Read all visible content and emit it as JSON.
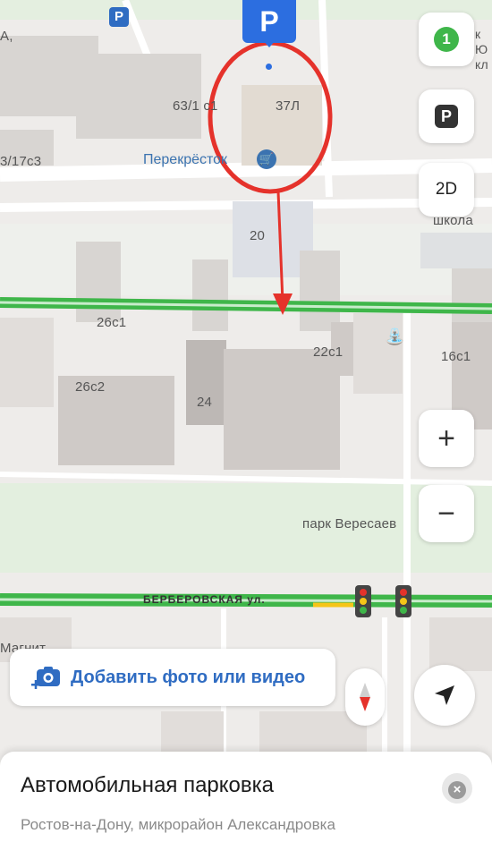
{
  "map": {
    "labels": {
      "a_partial": "А,",
      "b_63_1": "63/1 с1",
      "b_37l": "37Л",
      "b_17c3": "3/17с3",
      "b_20": "20",
      "b_26c1": "26с1",
      "b_22c1": "22с1",
      "b_16c1": "16с1",
      "b_26c2": "26с2",
      "b_24": "24",
      "park": "парк Вересаев",
      "school": "школа",
      "magnit": "Магнит",
      "top_right_1": "к",
      "top_right_2": "Ю",
      "top_right_3": "кл"
    },
    "street": "БЕРБЕРОВСКАЯ ул.",
    "poi": {
      "name": "Перекрёсток",
      "icon": "basket-icon"
    },
    "parking_marker": "P",
    "small_parking_icon": "P",
    "fountain_icon": "fountain-icon",
    "colors": {
      "annotation_red": "#e5322b",
      "road_green": "#3fb64a",
      "accent_blue": "#2c6ee0"
    }
  },
  "controls": {
    "traffic_badge": "1",
    "parking_button": "P",
    "view_toggle": "2D",
    "zoom_in": "+",
    "zoom_out": "−",
    "compass_icon": "compass-icon",
    "locate_icon": "location-arrow-icon"
  },
  "add_photo": {
    "label": "Добавить фото или видео",
    "icon": "camera-add-icon"
  },
  "sheet": {
    "title": "Автомобильная парковка",
    "subtitle": "Ростов-на-Дону, микрорайон Александровка",
    "close_icon": "close-icon"
  }
}
